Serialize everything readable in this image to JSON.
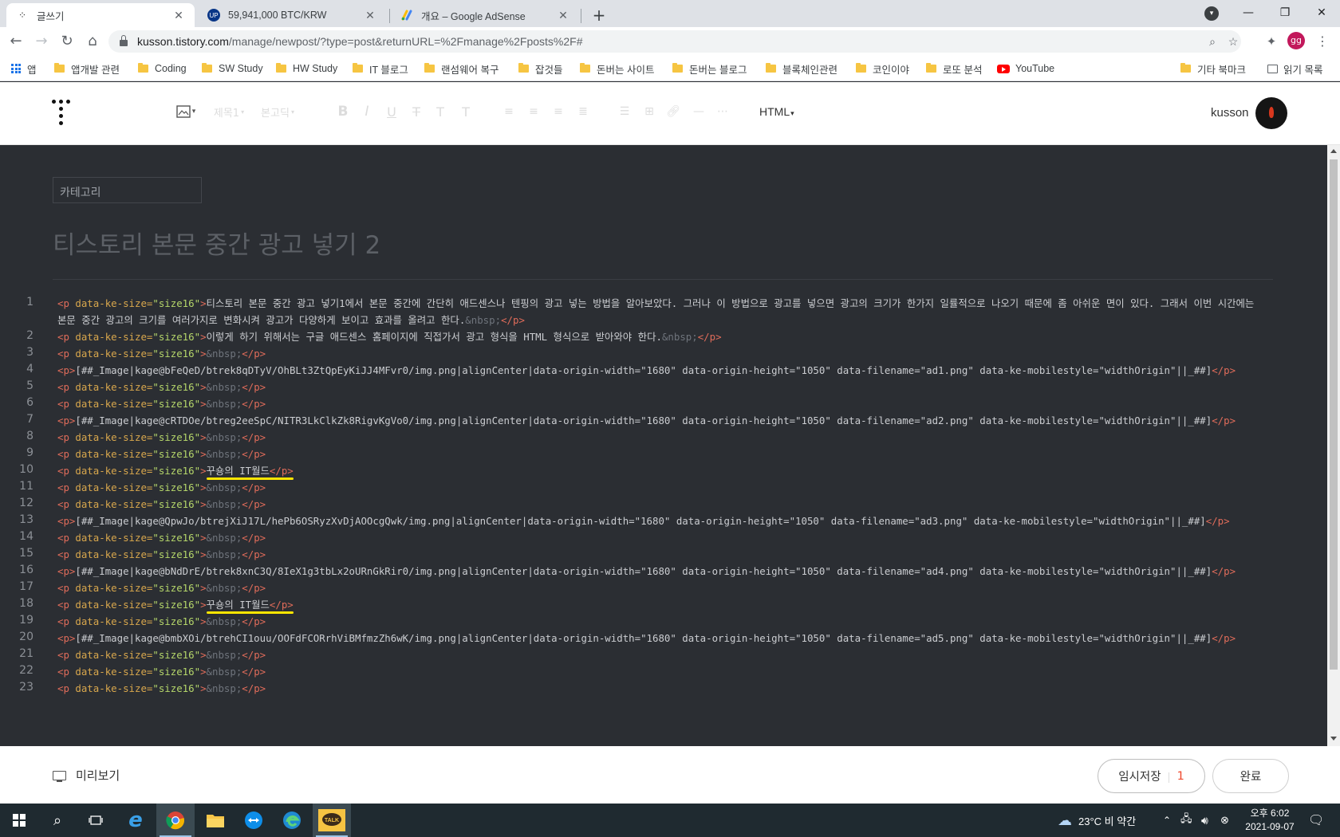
{
  "browser": {
    "tabs": [
      {
        "title": "글쓰기",
        "favicon": "tistory-icon"
      },
      {
        "title": "59,941,000 BTC/KRW",
        "favicon": "upbit-icon"
      },
      {
        "title": "개요 – Google AdSense",
        "favicon": "adsense-icon"
      }
    ],
    "url_host": "kusson.tistory.com",
    "url_path": "/manage/newpost/?type=post&returnURL=%2Fmanage%2Fposts%2F#",
    "profile_initials": "gg",
    "bookmarks": [
      {
        "label": "앱",
        "type": "apps"
      },
      {
        "label": "앱개발 관련",
        "type": "folder"
      },
      {
        "label": "Coding",
        "type": "folder"
      },
      {
        "label": "SW Study",
        "type": "folder"
      },
      {
        "label": "HW Study",
        "type": "folder"
      },
      {
        "label": "IT 블로그",
        "type": "folder"
      },
      {
        "label": "랜섬웨어 복구",
        "type": "folder"
      },
      {
        "label": "잡것들",
        "type": "folder"
      },
      {
        "label": "돈버는 사이트",
        "type": "folder"
      },
      {
        "label": "돈버는 블로그",
        "type": "folder"
      },
      {
        "label": "블록체인관련",
        "type": "folder"
      },
      {
        "label": "코인이야",
        "type": "folder"
      },
      {
        "label": "로또 분석",
        "type": "folder"
      },
      {
        "label": "YouTube",
        "type": "youtube"
      }
    ],
    "other_bookmarks": "기타 북마크",
    "reading_list": "읽기 목록"
  },
  "editor": {
    "toolbar": {
      "heading": "제목1",
      "font": "본고딕",
      "mode": "HTML"
    },
    "user": {
      "name": "kusson"
    },
    "category_placeholder": "카테고리",
    "title": "티스토리 본문 중간 광고 넣기 2",
    "lines": [
      {
        "n": "1",
        "html": "<span class=\"tag\">&lt;p</span> <span class=\"attr\">data-ke-size=</span><span class=\"val\">\"size16\"</span><span class=\"tag\">&gt;</span><span class=\"txt\">티스토리 본문 중간 광고 넣기1에서 본문 중간에 간단히 애드센스나 텐핑의 광고 넣는 방법을 알아보았다. 그러나 이 방법으로 광고를 넣으면 광고의 크기가 한가지 일률적으로 나오기 때문에 좀 아쉬운 면이 있다. 그래서 이번 시간에는 본문 중간 광고의 크기를 여러가지로 변화시켜 광고가 다양하게 보이고 효과를 올려고 한다.</span><span class=\"ent\">&amp;nbsp;</span><span class=\"tag\">&lt;/p&gt;</span>"
      },
      {
        "n": "2",
        "html": "<span class=\"tag\">&lt;p</span> <span class=\"attr\">data-ke-size=</span><span class=\"val\">\"size16\"</span><span class=\"tag\">&gt;</span><span class=\"txt\">이렇게 하기 위해서는 구글 애드센스 홈페이지에 직접가서 광고 형식을 HTML 형식으로 받아와야 한다.</span><span class=\"ent\">&amp;nbsp;</span><span class=\"tag\">&lt;/p&gt;</span>"
      },
      {
        "n": "3",
        "html": "<span class=\"tag\">&lt;p</span> <span class=\"attr\">data-ke-size=</span><span class=\"val\">\"size16\"</span><span class=\"tag\">&gt;</span><span class=\"ent\">&amp;nbsp;</span><span class=\"tag\">&lt;/p&gt;</span>"
      },
      {
        "n": "4",
        "html": "<span class=\"tag\">&lt;p&gt;</span><span class=\"txt\">[##_Image|kage@bFeQeD/btrek8qDTyV/OhBLt3ZtQpEyKiJJ4MFvr0/img.png|alignCenter|data-origin-width=\"1680\" data-origin-height=\"1050\" data-filename=\"ad1.png\" data-ke-mobilestyle=\"widthOrigin\"||_##]</span><span class=\"tag\">&lt;/p&gt;</span>"
      },
      {
        "n": "5",
        "html": "<span class=\"tag\">&lt;p</span> <span class=\"attr\">data-ke-size=</span><span class=\"val\">\"size16\"</span><span class=\"tag\">&gt;</span><span class=\"ent\">&amp;nbsp;</span><span class=\"tag\">&lt;/p&gt;</span>"
      },
      {
        "n": "6",
        "html": "<span class=\"tag\">&lt;p</span> <span class=\"attr\">data-ke-size=</span><span class=\"val\">\"size16\"</span><span class=\"tag\">&gt;</span><span class=\"ent\">&amp;nbsp;</span><span class=\"tag\">&lt;/p&gt;</span>"
      },
      {
        "n": "7",
        "html": "<span class=\"tag\">&lt;p&gt;</span><span class=\"txt\">[##_Image|kage@cRTDOe/btreg2eeSpC/NITR3LkClkZk8RigvKgVo0/img.png|alignCenter|data-origin-width=\"1680\" data-origin-height=\"1050\" data-filename=\"ad2.png\" data-ke-mobilestyle=\"widthOrigin\"||_##]</span><span class=\"tag\">&lt;/p&gt;</span>"
      },
      {
        "n": "8",
        "html": "<span class=\"tag\">&lt;p</span> <span class=\"attr\">data-ke-size=</span><span class=\"val\">\"size16\"</span><span class=\"tag\">&gt;</span><span class=\"ent\">&amp;nbsp;</span><span class=\"tag\">&lt;/p&gt;</span>"
      },
      {
        "n": "9",
        "html": "<span class=\"tag\">&lt;p</span> <span class=\"attr\">data-ke-size=</span><span class=\"val\">\"size16\"</span><span class=\"tag\">&gt;</span><span class=\"ent\">&amp;nbsp;</span><span class=\"tag\">&lt;/p&gt;</span>"
      },
      {
        "n": "10",
        "html": "<span class=\"tag\">&lt;p</span> <span class=\"attr\">data-ke-size=</span><span class=\"val\">\"size16\"</span><span class=\"tag\">&gt;</span><span class=\"txt\">꾸숑의 IT월드</span><span class=\"tag\">&lt;/p&gt;</span>",
        "highlight": true
      },
      {
        "n": "11",
        "html": "<span class=\"tag\">&lt;p</span> <span class=\"attr\">data-ke-size=</span><span class=\"val\">\"size16\"</span><span class=\"tag\">&gt;</span><span class=\"ent\">&amp;nbsp;</span><span class=\"tag\">&lt;/p&gt;</span>"
      },
      {
        "n": "12",
        "html": "<span class=\"tag\">&lt;p</span> <span class=\"attr\">data-ke-size=</span><span class=\"val\">\"size16\"</span><span class=\"tag\">&gt;</span><span class=\"ent\">&amp;nbsp;</span><span class=\"tag\">&lt;/p&gt;</span>"
      },
      {
        "n": "13",
        "html": "<span class=\"tag\">&lt;p&gt;</span><span class=\"txt\">[##_Image|kage@QpwJo/btrejXiJ17L/hePb6OSRyzXvDjAOOcgQwk/img.png|alignCenter|data-origin-width=\"1680\" data-origin-height=\"1050\" data-filename=\"ad3.png\" data-ke-mobilestyle=\"widthOrigin\"||_##]</span><span class=\"tag\">&lt;/p&gt;</span>"
      },
      {
        "n": "14",
        "html": "<span class=\"tag\">&lt;p</span> <span class=\"attr\">data-ke-size=</span><span class=\"val\">\"size16\"</span><span class=\"tag\">&gt;</span><span class=\"ent\">&amp;nbsp;</span><span class=\"tag\">&lt;/p&gt;</span>"
      },
      {
        "n": "15",
        "html": "<span class=\"tag\">&lt;p</span> <span class=\"attr\">data-ke-size=</span><span class=\"val\">\"size16\"</span><span class=\"tag\">&gt;</span><span class=\"ent\">&amp;nbsp;</span><span class=\"tag\">&lt;/p&gt;</span>"
      },
      {
        "n": "16",
        "html": "<span class=\"tag\">&lt;p&gt;</span><span class=\"txt\">[##_Image|kage@bNdDrE/btrek8xnC3Q/8IeX1g3tbLx2oURnGkRir0/img.png|alignCenter|data-origin-width=\"1680\" data-origin-height=\"1050\" data-filename=\"ad4.png\" data-ke-mobilestyle=\"widthOrigin\"||_##]</span><span class=\"tag\">&lt;/p&gt;</span>"
      },
      {
        "n": "17",
        "html": "<span class=\"tag\">&lt;p</span> <span class=\"attr\">data-ke-size=</span><span class=\"val\">\"size16\"</span><span class=\"tag\">&gt;</span><span class=\"ent\">&amp;nbsp;</span><span class=\"tag\">&lt;/p&gt;</span>"
      },
      {
        "n": "18",
        "html": "<span class=\"tag\">&lt;p</span> <span class=\"attr\">data-ke-size=</span><span class=\"val\">\"size16\"</span><span class=\"tag\">&gt;</span><span class=\"txt\">꾸숑의 IT월드</span><span class=\"tag\">&lt;/p&gt;</span>",
        "highlight": true
      },
      {
        "n": "19",
        "html": "<span class=\"tag\">&lt;p</span> <span class=\"attr\">data-ke-size=</span><span class=\"val\">\"size16\"</span><span class=\"tag\">&gt;</span><span class=\"ent\">&amp;nbsp;</span><span class=\"tag\">&lt;/p&gt;</span>"
      },
      {
        "n": "20",
        "html": "<span class=\"tag\">&lt;p&gt;</span><span class=\"txt\">[##_Image|kage@bmbXOi/btrehCI1ouu/OOFdFCORrhViBMfmzZh6wK/img.png|alignCenter|data-origin-width=\"1680\" data-origin-height=\"1050\" data-filename=\"ad5.png\" data-ke-mobilestyle=\"widthOrigin\"||_##]</span><span class=\"tag\">&lt;/p&gt;</span>"
      },
      {
        "n": "21",
        "html": "<span class=\"tag\">&lt;p</span> <span class=\"attr\">data-ke-size=</span><span class=\"val\">\"size16\"</span><span class=\"tag\">&gt;</span><span class=\"ent\">&amp;nbsp;</span><span class=\"tag\">&lt;/p&gt;</span>"
      },
      {
        "n": "22",
        "html": "<span class=\"tag\">&lt;p</span> <span class=\"attr\">data-ke-size=</span><span class=\"val\">\"size16\"</span><span class=\"tag\">&gt;</span><span class=\"ent\">&amp;nbsp;</span><span class=\"tag\">&lt;/p&gt;</span>"
      },
      {
        "n": "23",
        "html": "<span class=\"tag\">&lt;p</span> <span class=\"attr\">data-ke-size=</span><span class=\"val\">\"size16\"</span><span class=\"tag\">&gt;</span><span class=\"ent\">&amp;nbsp;</span><span class=\"tag\">&lt;/p&gt;</span>"
      }
    ],
    "footer": {
      "preview": "미리보기",
      "temp_save": "임시저장",
      "temp_save_count": "1",
      "done": "완료"
    }
  },
  "taskbar": {
    "weather": "23°C  비 약간",
    "time": "오후 6:02",
    "date": "2021-09-07"
  },
  "colors": {
    "editor_bg": "#2b2e33",
    "tag": "#e06c5a",
    "attr": "#d8a74d",
    "value": "#b5d66a",
    "highlight": "#ffe600",
    "temp_save_count": "#f0472b"
  }
}
